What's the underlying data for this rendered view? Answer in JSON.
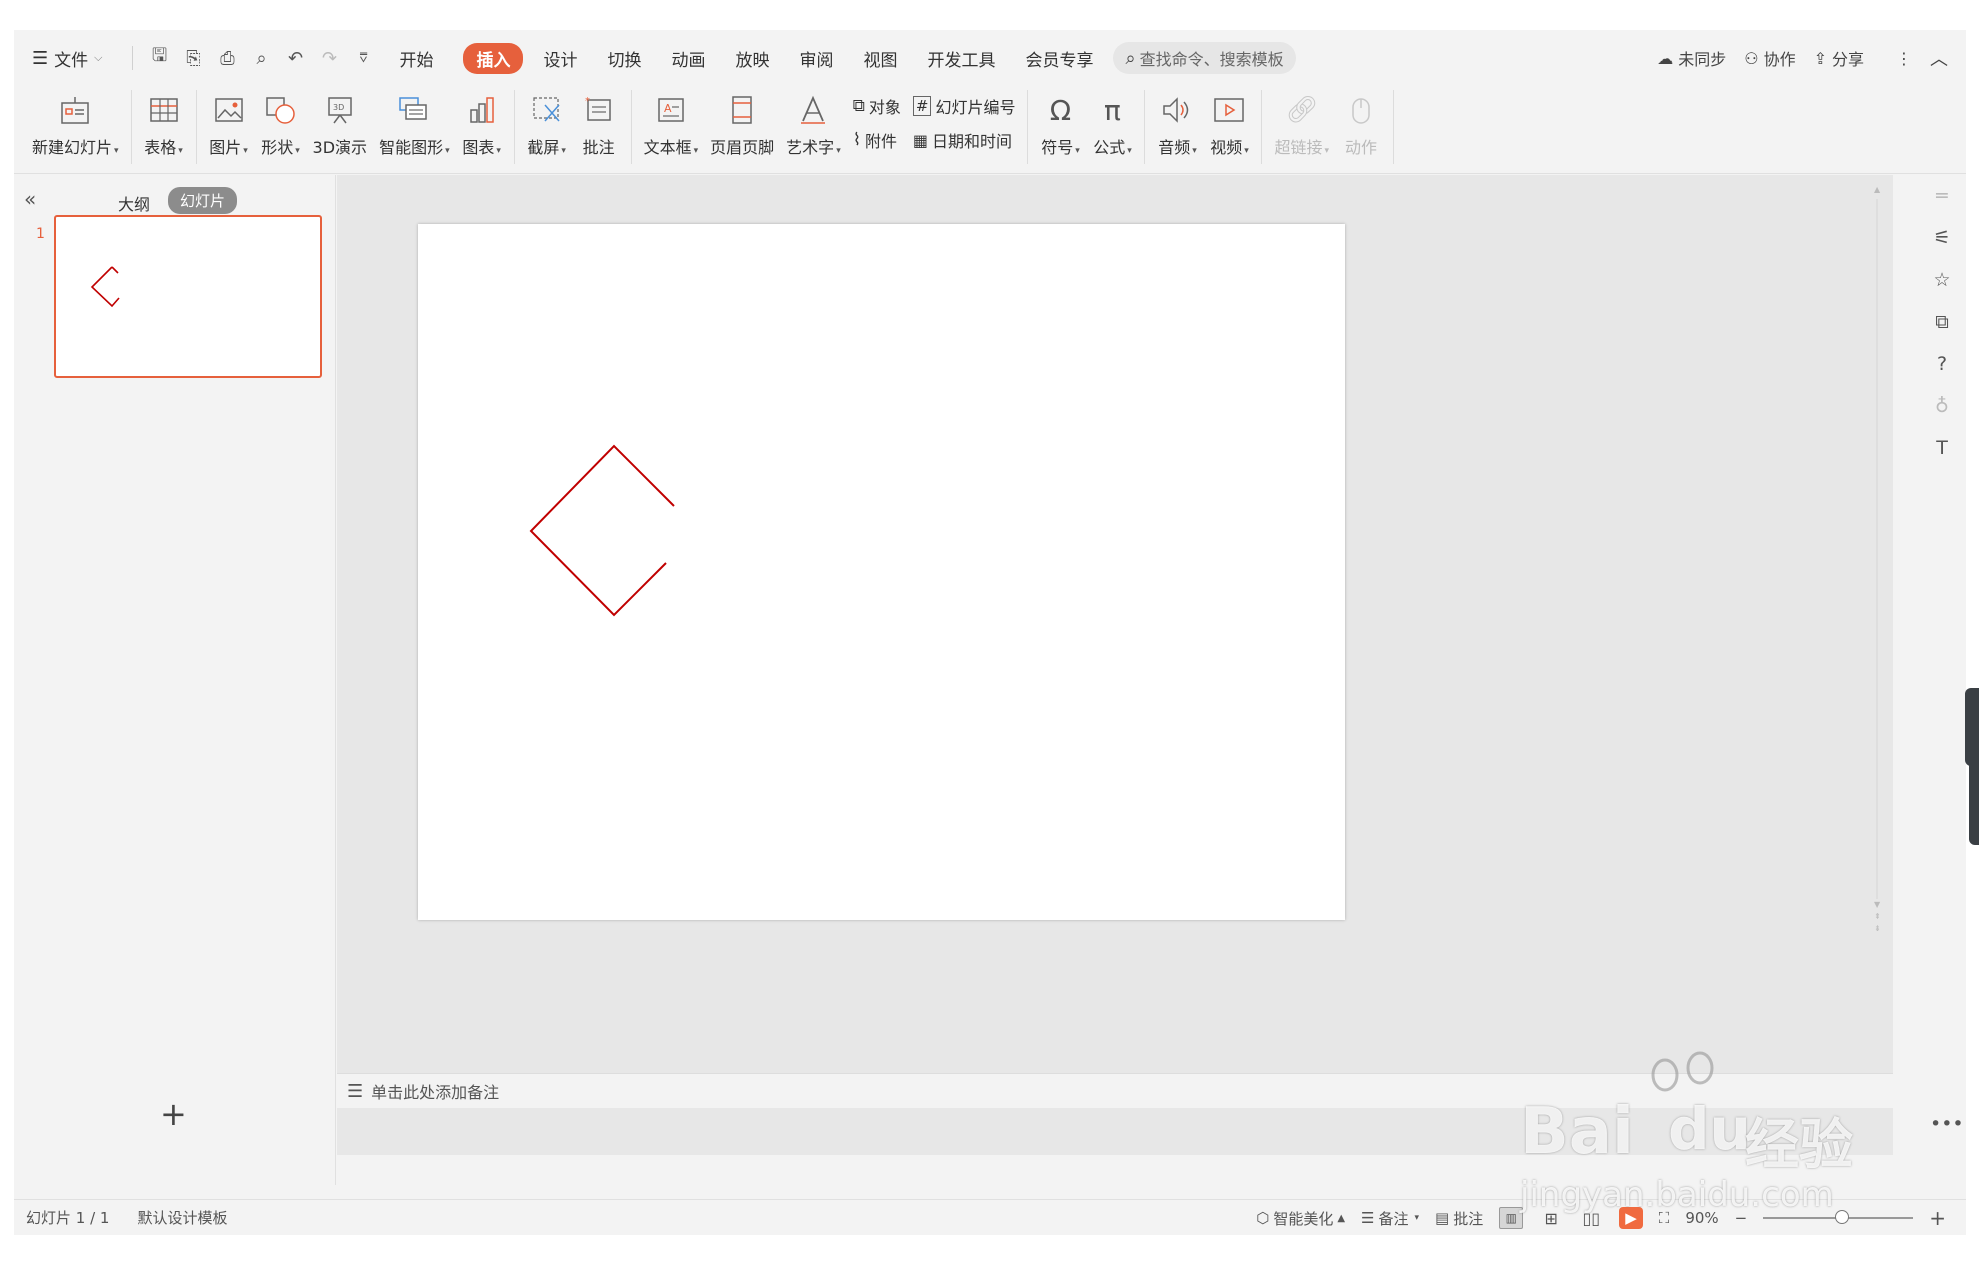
{
  "menu": {
    "file": "文件",
    "tabs": [
      "开始",
      "插入",
      "设计",
      "切换",
      "动画",
      "放映",
      "审阅",
      "视图",
      "开发工具",
      "会员专享"
    ],
    "active_tab": "插入",
    "search_placeholder": "查找命令、搜索模板",
    "right": {
      "sync": "未同步",
      "collab": "协作",
      "share": "分享"
    }
  },
  "ribbon": {
    "new_slide": "新建幻灯片",
    "table": "表格",
    "picture": "图片",
    "shape": "形状",
    "demo3d": "3D演示",
    "smartart": "智能图形",
    "chart": "图表",
    "screenshot": "截屏",
    "comment": "批注",
    "textbox": "文本框",
    "header_footer": "页眉页脚",
    "wordart": "艺术字",
    "object": "对象",
    "attachment": "附件",
    "slide_number": "幻灯片编号",
    "datetime": "日期和时间",
    "symbol": "符号",
    "formula": "公式",
    "audio": "音频",
    "video": "视频",
    "hyperlink": "超链接",
    "action": "动作"
  },
  "left_panel": {
    "tab_outline": "大纲",
    "tab_slides": "幻灯片",
    "slide_number": "1",
    "add_icon": "+"
  },
  "notes": {
    "placeholder": "单击此处添加备注"
  },
  "status": {
    "slide_info": "幻灯片 1 / 1",
    "template": "默认设计模板",
    "beautify": "智能美化",
    "notes": "备注",
    "comments": "批注",
    "zoom": "90%"
  },
  "watermark": {
    "brand": "Bai",
    "brand2": "du",
    "cn": "经验",
    "url": "jingyan.baidu.com"
  },
  "colors": {
    "accent": "#e6603c",
    "shape_stroke": "#c00000"
  }
}
